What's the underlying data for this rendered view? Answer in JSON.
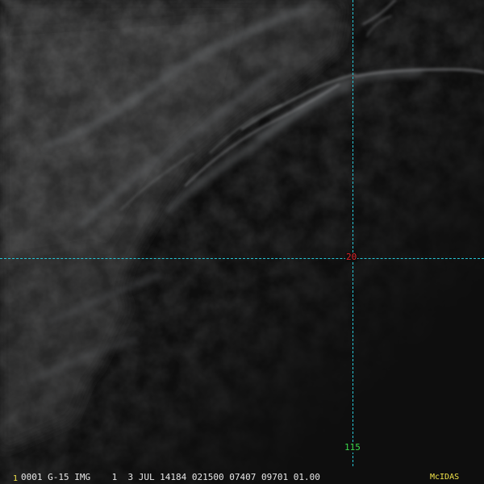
{
  "image": {
    "subject": "grayscale satellite view",
    "background_color": "#0e0e0e",
    "cloud_color": "#bfc3c6"
  },
  "overlay": {
    "grid_color": "#27c6d6",
    "latitude_label": "20",
    "latitude_label_color": "#e0242a",
    "longitude_label": "115",
    "longitude_label_color": "#3bd64a"
  },
  "status_bar": {
    "frame_number": "1",
    "text": "0001 G-15 IMG    1  3 JUL 14184 021500 07407 09701 01.00",
    "logo": "McIDAS",
    "accent_color": "#f2e44a"
  }
}
